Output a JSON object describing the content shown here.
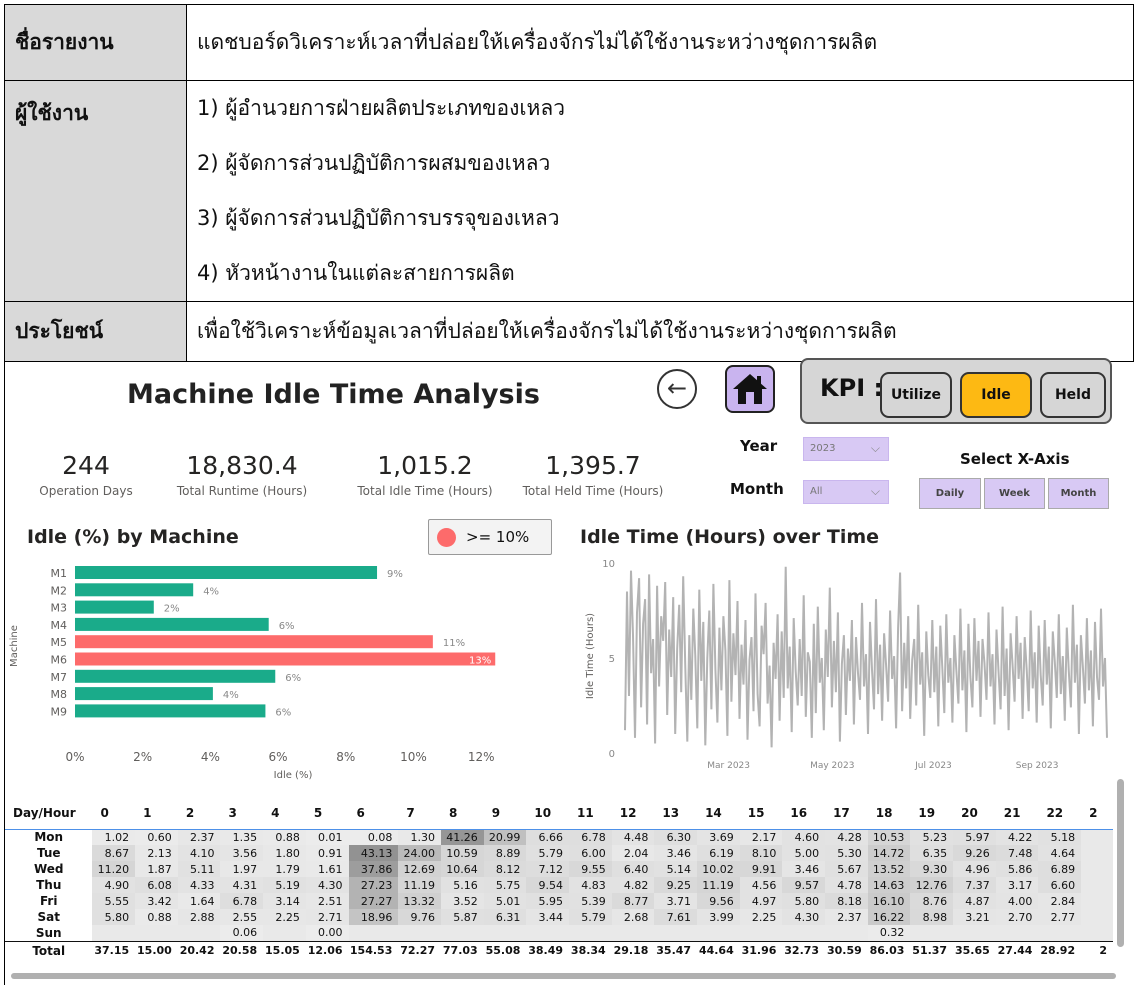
{
  "report": {
    "name_label": "ชื่อรายงาน",
    "name_value": "แดชบอร์ดวิเคราะห์เวลาที่ปล่อยให้เครื่องจักรไม่ได้ใช้งานระหว่างชุดการผลิต",
    "users_label": "ผู้ใช้งาน",
    "users": [
      "1) ผู้อำนวยการฝ่ายผลิตประเภทของเหลว",
      "2) ผู้จัดการส่วนปฏิบัติการผสมของเหลว",
      "3) ผู้จัดการส่วนปฏิบัติการบรรจุของเหลว",
      "4) หัวหน้างานในแต่ละสายการผลิต"
    ],
    "benefit_label": "ประโยชน์",
    "benefit_value": "เพื่อใช้วิเคราะห์ข้อมูลเวลาที่ปล่อยให้เครื่องจักรไม่ได้ใช้งานระหว่างชุดการผลิต"
  },
  "dashboard": {
    "title": "Machine Idle Time Analysis",
    "back_icon": "back-arrow-icon",
    "home_icon": "home-icon",
    "kpi": {
      "label": "KPI :",
      "buttons": [
        "Utilize",
        "Idle",
        "Held"
      ],
      "active": "Idle",
      "active_color": "#fdb913",
      "inactive_color": "#d6d6d6"
    },
    "stats": [
      {
        "value": "244",
        "caption": "Operation Days"
      },
      {
        "value": "18,830.4",
        "caption": "Total Runtime (Hours)"
      },
      {
        "value": "1,015.2",
        "caption": "Total Idle Time (Hours)"
      },
      {
        "value": "1,395.7",
        "caption": "Total Held Time (Hours)"
      }
    ],
    "filters": {
      "year_label": "Year",
      "year_value": "2023",
      "month_label": "Month",
      "month_value": "All",
      "xaxis_title": "Select X-Axis",
      "xaxis_buttons": [
        "Daily",
        "Week",
        "Month"
      ]
    },
    "bar_section_title": "Idle (%) by Machine",
    "legend_label": ">= 10%",
    "line_section_title": "Idle Time (Hours) over Time"
  },
  "chart_data": [
    {
      "type": "bar",
      "orientation": "horizontal",
      "categories": [
        "M1",
        "M2",
        "M3",
        "M4",
        "M5",
        "M6",
        "M7",
        "M8",
        "M9"
      ],
      "values": [
        9.2,
        3.6,
        2.4,
        5.9,
        10.9,
        12.8,
        6.1,
        4.2,
        5.8
      ],
      "labels": [
        "9%",
        "4%",
        "2%",
        "6%",
        "11%",
        "13%",
        "6%",
        "4%",
        "6%"
      ],
      "xlabel": "Idle (%)",
      "ylabel": "Machine",
      "xlim": [
        0,
        13
      ],
      "xticks": [
        "0%",
        "2%",
        "4%",
        "6%",
        "8%",
        "10%",
        "12%"
      ],
      "colors": {
        "normal": "#1aab8a",
        "highlight": "#fd6b6b"
      },
      "highlight_threshold": 10
    },
    {
      "type": "line",
      "xlabel": "",
      "ylabel": "Idle Time (Hours)",
      "ylim": [
        0,
        10
      ],
      "yticks": [
        "0",
        "5",
        "10"
      ],
      "xticks": [
        "Mar 2023",
        "May 2023",
        "Jul 2023",
        "Sep 2023"
      ],
      "xrange": [
        "2023-01-01",
        "2023-10-15"
      ],
      "color": "#b3b3b3",
      "values": [
        1.2,
        8.5,
        3.0,
        9.6,
        6.2,
        0.8,
        7.4,
        9.2,
        2.4,
        6.8,
        8.1,
        1.5,
        9.4,
        4.2,
        6.0,
        0.5,
        8.8,
        3.5,
        7.2,
        5.9,
        9.0,
        2.0,
        6.5,
        4.0,
        8.2,
        1.0,
        5.5,
        7.8,
        3.2,
        9.3,
        4.5,
        0.6,
        6.2,
        2.8,
        7.6,
        5.1,
        1.3,
        8.6,
        3.8,
        6.9,
        0.4,
        5.0,
        7.5,
        2.3,
        8.9,
        4.4,
        1.6,
        6.6,
        3.3,
        7.2,
        5.4,
        0.9,
        9.1,
        2.7,
        6.3,
        4.1,
        8.0,
        1.8,
        5.7,
        3.6,
        7.0,
        0.7,
        4.9,
        6.1,
        2.2,
        8.4,
        3.1,
        1.4,
        6.7,
        5.2,
        7.9,
        2.6,
        4.6,
        0.3,
        5.8,
        3.9,
        7.3,
        1.7,
        6.4,
        2.9,
        9.8,
        3.4,
        5.6,
        1.1,
        7.1,
        4.3,
        2.5,
        6.0,
        3.0,
        8.3,
        1.9,
        5.3,
        4.8,
        0.8,
        6.8,
        2.1,
        7.7,
        3.7,
        5.0,
        1.2,
        6.5,
        4.0,
        8.7,
        2.4,
        5.9,
        3.2,
        7.4,
        0.6,
        4.7,
        6.2,
        2.0,
        5.5,
        3.8,
        7.0,
        1.5,
        6.1,
        4.2,
        2.8,
        7.9,
        3.5,
        5.2,
        1.0,
        6.9,
        4.4,
        2.3,
        8.1,
        3.1,
        5.7,
        1.7,
        6.3,
        4.6,
        2.7,
        7.5,
        3.9,
        5.1,
        1.3,
        6.6,
        9.5,
        2.2,
        5.8,
        3.4,
        7.2,
        1.8,
        4.9,
        6.0,
        2.5,
        7.8,
        3.6,
        5.3,
        0.9,
        6.4,
        4.1,
        2.9,
        7.0,
        3.2,
        5.6,
        1.4,
        6.7,
        4.5,
        2.1,
        7.3,
        3.7,
        5.0,
        1.6,
        6.2,
        4.3,
        2.6,
        7.6,
        3.3,
        5.4,
        1.1,
        6.8,
        4.0,
        2.4,
        7.1,
        3.8,
        5.9,
        1.9,
        6.0,
        4.7,
        2.8,
        7.4,
        3.5,
        5.2,
        1.5,
        6.5,
        4.2,
        2.3,
        7.7,
        3.0,
        5.5,
        1.2,
        6.3,
        4.6,
        2.7,
        7.2,
        3.9,
        5.8,
        1.8,
        6.1,
        4.4,
        2.2,
        7.5,
        3.4,
        5.3,
        1.6,
        6.7,
        4.1,
        2.5,
        7.0,
        3.6,
        5.6,
        1.3,
        6.4,
        4.8,
        2.9,
        7.3,
        3.1,
        5.1,
        1.7,
        6.6,
        4.3,
        2.4,
        7.8,
        3.7,
        5.7,
        1.0,
        6.2,
        4.5,
        2.6,
        7.1,
        3.3,
        5.4,
        1.4,
        6.9,
        4.0,
        2.8,
        7.6,
        3.5,
        5.0,
        0.8
      ]
    },
    {
      "type": "heatmap",
      "corner_label": "Day/Hour",
      "columns": [
        "0",
        "1",
        "2",
        "3",
        "4",
        "5",
        "6",
        "7",
        "8",
        "9",
        "10",
        "11",
        "12",
        "13",
        "14",
        "15",
        "16",
        "17",
        "18",
        "19",
        "20",
        "21",
        "22",
        "2"
      ],
      "rows": [
        {
          "day": "Mon",
          "values": [
            "1.02",
            "0.60",
            "2.37",
            "1.35",
            "0.88",
            "0.01",
            "0.08",
            "1.30",
            "41.26",
            "20.99",
            "6.66",
            "6.78",
            "4.48",
            "6.30",
            "3.69",
            "2.17",
            "4.60",
            "4.28",
            "10.53",
            "5.23",
            "5.97",
            "4.22",
            "5.18",
            ""
          ]
        },
        {
          "day": "Tue",
          "values": [
            "8.67",
            "2.13",
            "4.10",
            "3.56",
            "1.80",
            "0.91",
            "43.13",
            "24.00",
            "10.59",
            "8.89",
            "5.79",
            "6.00",
            "2.04",
            "3.46",
            "6.19",
            "8.10",
            "5.00",
            "5.30",
            "14.72",
            "6.35",
            "9.26",
            "7.48",
            "4.64",
            ""
          ]
        },
        {
          "day": "Wed",
          "values": [
            "11.20",
            "1.87",
            "5.11",
            "1.97",
            "1.79",
            "1.61",
            "37.86",
            "12.69",
            "10.64",
            "8.12",
            "7.12",
            "9.55",
            "6.40",
            "5.14",
            "10.02",
            "9.91",
            "3.46",
            "5.67",
            "13.52",
            "9.30",
            "4.96",
            "5.86",
            "6.89",
            ""
          ]
        },
        {
          "day": "Thu",
          "values": [
            "4.90",
            "6.08",
            "4.33",
            "4.31",
            "5.19",
            "4.30",
            "27.23",
            "11.19",
            "5.16",
            "5.75",
            "9.54",
            "4.83",
            "4.82",
            "9.25",
            "11.19",
            "4.56",
            "9.57",
            "4.78",
            "14.63",
            "12.76",
            "7.37",
            "3.17",
            "6.60",
            ""
          ]
        },
        {
          "day": "Fri",
          "values": [
            "5.55",
            "3.42",
            "1.64",
            "6.78",
            "3.14",
            "2.51",
            "27.27",
            "13.32",
            "3.52",
            "5.01",
            "5.95",
            "5.39",
            "8.77",
            "3.71",
            "9.56",
            "4.97",
            "5.80",
            "8.18",
            "16.10",
            "8.76",
            "4.87",
            "4.00",
            "2.84",
            ""
          ]
        },
        {
          "day": "Sat",
          "values": [
            "5.80",
            "0.88",
            "2.88",
            "2.55",
            "2.25",
            "2.71",
            "18.96",
            "9.76",
            "5.87",
            "6.31",
            "3.44",
            "5.79",
            "2.68",
            "7.61",
            "3.99",
            "2.25",
            "4.30",
            "2.37",
            "16.22",
            "8.98",
            "3.21",
            "2.70",
            "2.77",
            ""
          ]
        },
        {
          "day": "Sun",
          "values": [
            "",
            "",
            "",
            "0.06",
            "",
            "0.00",
            "",
            "",
            "",
            "",
            "",
            "",
            "",
            "",
            "",
            "",
            "",
            "",
            "0.32",
            "",
            "",
            "",
            "",
            ""
          ]
        }
      ],
      "total": {
        "label": "Total",
        "values": [
          "37.15",
          "15.00",
          "20.42",
          "20.58",
          "15.05",
          "12.06",
          "154.53",
          "72.27",
          "77.03",
          "55.08",
          "38.49",
          "38.34",
          "29.18",
          "35.47",
          "44.64",
          "31.96",
          "32.73",
          "30.59",
          "86.03",
          "51.37",
          "35.65",
          "27.44",
          "28.92",
          "2"
        ]
      }
    }
  ]
}
